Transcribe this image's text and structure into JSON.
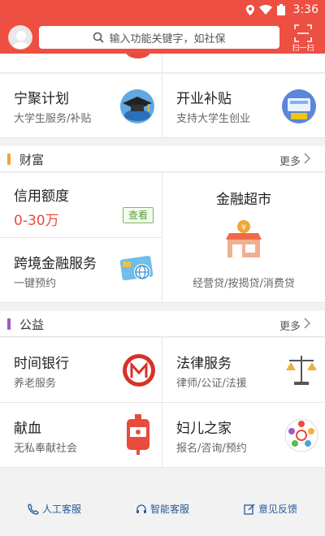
{
  "status_bar": {
    "time": "3:36"
  },
  "header": {
    "search_placeholder": "输入功能关键字，如社保",
    "scan_label": "扫一扫"
  },
  "top_cards": [
    {
      "title": "宁聚计划",
      "subtitle": "大学生服务/补贴"
    },
    {
      "title": "开业补贴",
      "subtitle": "支持大学生创业"
    }
  ],
  "wealth": {
    "title": "财富",
    "more": "更多",
    "credit": {
      "title": "信用额度",
      "amount": "0-30万",
      "button": "查看"
    },
    "cross_border": {
      "title": "跨境金融服务",
      "subtitle": "一键预约"
    },
    "finance_market": {
      "title": "金融超市",
      "subtitle": "经营贷/按揭贷/消费贷"
    }
  },
  "charity": {
    "title": "公益",
    "more": "更多",
    "items": [
      {
        "title": "时间银行",
        "subtitle": "养老服务"
      },
      {
        "title": "法律服务",
        "subtitle": "律师/公证/法援"
      },
      {
        "title": "献血",
        "subtitle": "无私奉献社会"
      },
      {
        "title": "妇儿之家",
        "subtitle": "报名/咨询/预约"
      }
    ]
  },
  "bottom_bar": {
    "items": [
      {
        "label": "人工客服"
      },
      {
        "label": "智能客服"
      },
      {
        "label": "意见反馈"
      }
    ]
  },
  "colors": {
    "brand": "#ee4f43",
    "wealth_accent": "#f2a33a",
    "charity_accent": "#9a5cc6",
    "link": "#2a5a9c"
  }
}
